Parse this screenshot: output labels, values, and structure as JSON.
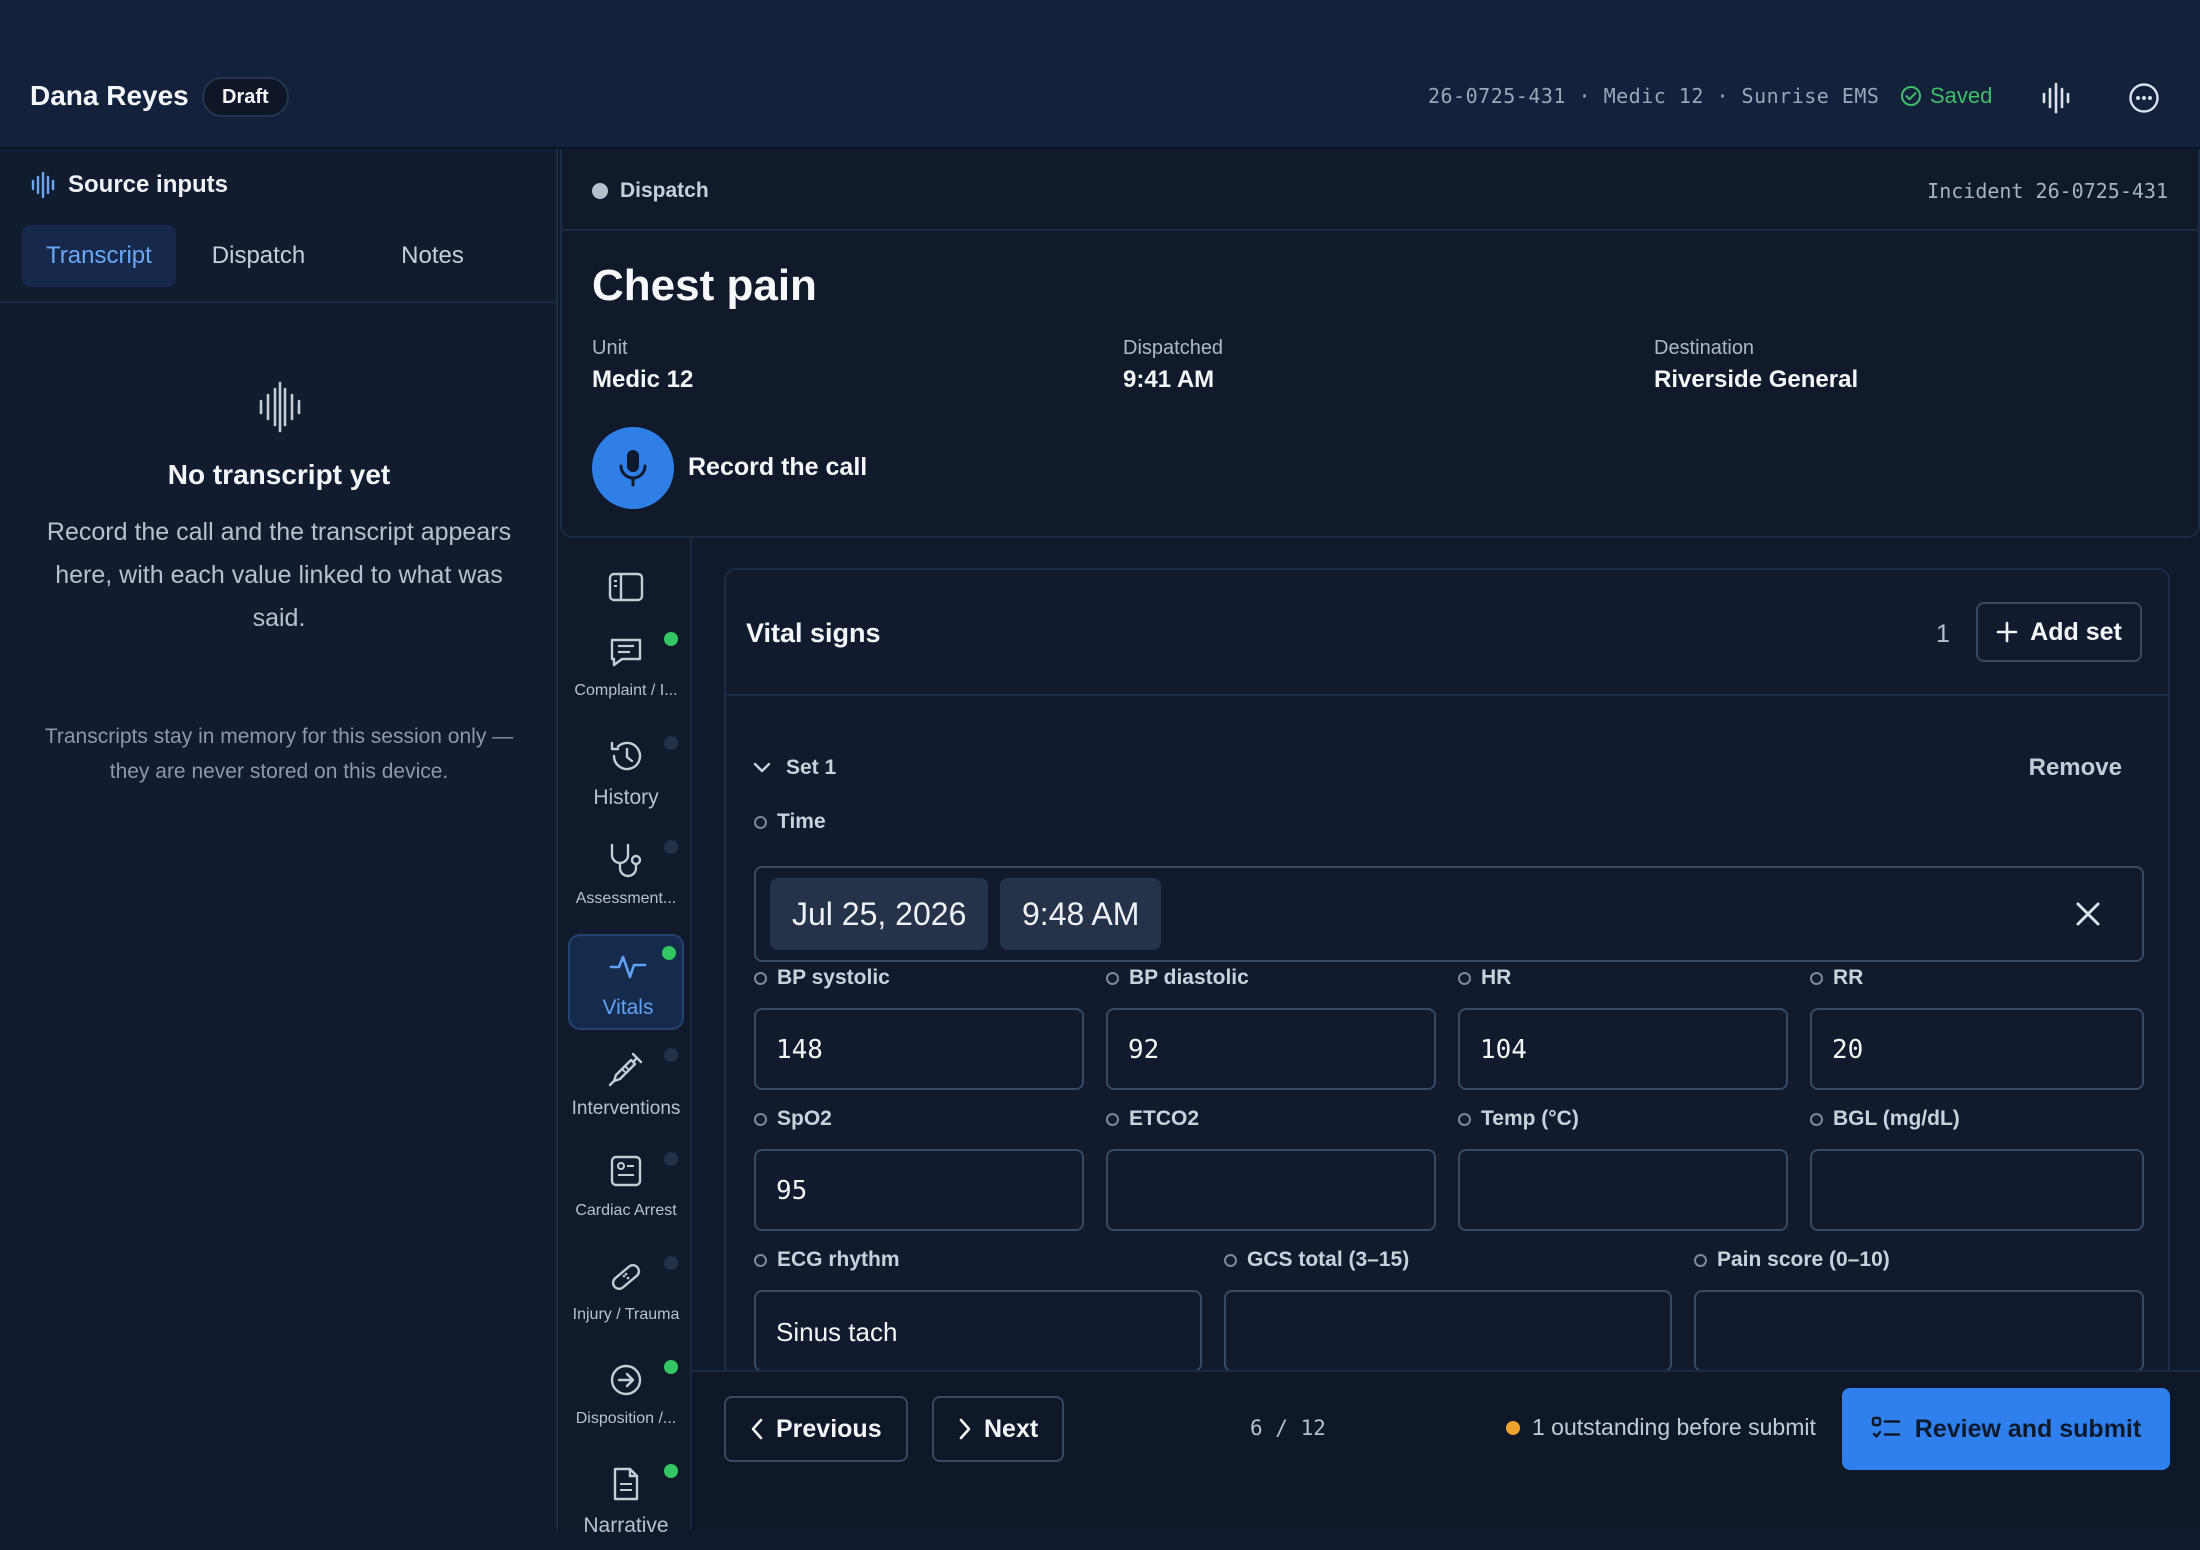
{
  "header": {
    "user_name": "Dana Reyes",
    "status_badge": "Draft",
    "incident_meta": "26-0725-431 · Medic 12 · Sunrise EMS",
    "saved_label": "Saved"
  },
  "source_panel": {
    "title": "Source inputs",
    "tabs": [
      "Transcript",
      "Dispatch",
      "Notes"
    ],
    "active_tab": "Transcript",
    "empty_title": "No transcript yet",
    "empty_body": "Record the call and the transcript appears here, with each value linked to what was said.",
    "privacy_note": "Transcripts stay in memory for this session only — they are never stored on this device."
  },
  "dispatch": {
    "label": "Dispatch",
    "incident": "Incident 26-0725-431",
    "complaint": "Chest pain",
    "facts": [
      {
        "label": "Unit",
        "value": "Medic 12"
      },
      {
        "label": "Dispatched",
        "value": "9:41 AM"
      },
      {
        "label": "Destination",
        "value": "Riverside General"
      }
    ],
    "record_label": "Record the call"
  },
  "nav": {
    "items": [
      {
        "label": "Complaint / I...",
        "icon": "chat-icon",
        "status": "complete"
      },
      {
        "label": "History",
        "icon": "history-icon",
        "status": "empty"
      },
      {
        "label": "Assessment...",
        "icon": "stethoscope-icon",
        "status": "empty"
      },
      {
        "label": "Vitals",
        "icon": "pulse-icon",
        "status": "complete",
        "active": true
      },
      {
        "label": "Interventions",
        "icon": "syringe-icon",
        "status": "empty"
      },
      {
        "label": "Cardiac Arrest",
        "icon": "monitor-icon",
        "status": "empty"
      },
      {
        "label": "Injury / Trauma",
        "icon": "bandage-icon",
        "status": "empty"
      },
      {
        "label": "Disposition /...",
        "icon": "arrow-circle-icon",
        "status": "complete"
      },
      {
        "label": "Narrative",
        "icon": "document-icon",
        "status": "complete"
      }
    ]
  },
  "vitals": {
    "title": "Vital signs",
    "set_count": "1",
    "add_set_label": "Add set",
    "set_label": "Set 1",
    "remove_label": "Remove",
    "time_label": "Time",
    "date_value": "Jul 25, 2026",
    "time_value": "9:48 AM",
    "fields": {
      "bp_systolic": {
        "label": "BP systolic",
        "value": "148"
      },
      "bp_diastolic": {
        "label": "BP diastolic",
        "value": "92"
      },
      "hr": {
        "label": "HR",
        "value": "104"
      },
      "rr": {
        "label": "RR",
        "value": "20"
      },
      "spo2": {
        "label": "SpO2",
        "value": "95"
      },
      "etco2": {
        "label": "ETCO2",
        "value": ""
      },
      "temp": {
        "label": "Temp (°C)",
        "value": ""
      },
      "bgl": {
        "label": "BGL (mg/dL)",
        "value": ""
      },
      "ecg": {
        "label": "ECG rhythm",
        "value": "Sinus tach"
      },
      "gcs": {
        "label": "GCS total (3–15)",
        "value": ""
      },
      "pain": {
        "label": "Pain score (0–10)",
        "value": ""
      }
    }
  },
  "footer": {
    "previous_label": "Previous",
    "next_label": "Next",
    "page_indicator": "6 / 12",
    "outstanding_text": "1 outstanding before submit",
    "submit_label": "Review and submit"
  },
  "colors": {
    "accent": "#2f80ed",
    "success": "#34c564",
    "warning": "#f0a22e",
    "background": "#0f1a2c"
  }
}
